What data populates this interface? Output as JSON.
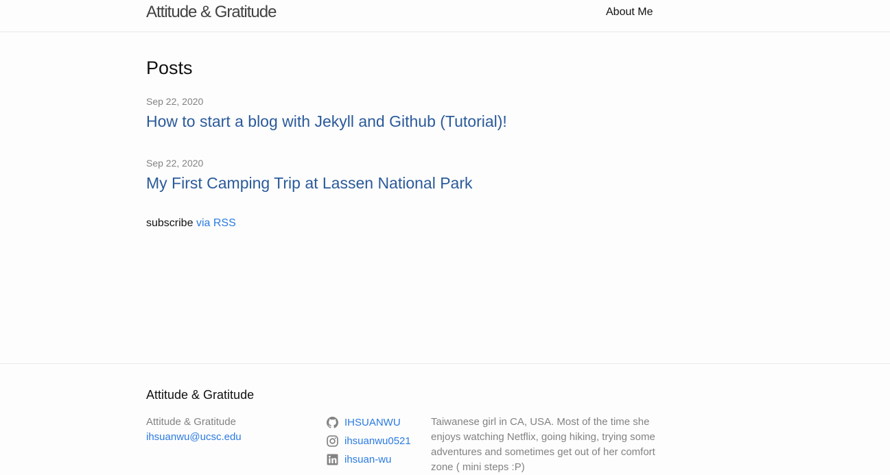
{
  "header": {
    "site_title": "Attitude & Gratitude",
    "nav": [
      {
        "label": "About Me"
      }
    ]
  },
  "main": {
    "heading": "Posts",
    "posts": [
      {
        "date": "Sep 22, 2020",
        "title": "How to start a blog with Jekyll and Github (Tutorial)!"
      },
      {
        "date": "Sep 22, 2020",
        "title": "My First Camping Trip at Lassen National Park"
      }
    ],
    "rss": {
      "prefix": "subscribe",
      "link_label": "via RSS"
    }
  },
  "footer": {
    "heading": "Attitude & Gratitude",
    "contact": {
      "name": "Attitude & Gratitude",
      "email": "ihsuanwu@ucsc.edu"
    },
    "social": [
      {
        "icon": "github-icon",
        "label": "IHSUANWU"
      },
      {
        "icon": "instagram-icon",
        "label": "ihsuanwu0521"
      },
      {
        "icon": "linkedin-icon",
        "label": "ihsuan-wu"
      }
    ],
    "description": "Taiwanese girl in CA, USA. Most of the time she enjoys watching Netflix, going hiking, trying some adventures and sometimes get out of her comfort zone ( mini steps :P)"
  },
  "colors": {
    "link": "#2a7ae2",
    "post_link": "#2a5a9a",
    "muted_text": "#828282",
    "border": "#e8e8e8",
    "background": "#fdfdfd"
  }
}
